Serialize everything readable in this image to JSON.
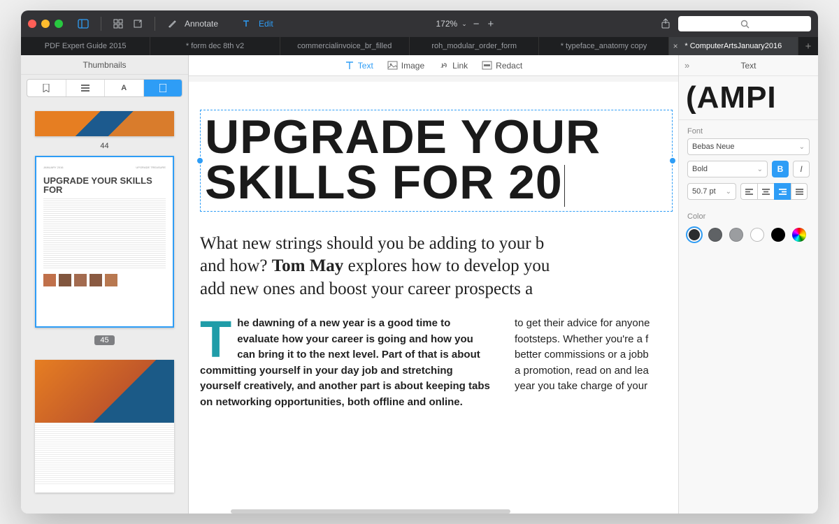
{
  "toolbar": {
    "annotate": "Annotate",
    "edit": "Edit",
    "zoom": "172%"
  },
  "search": {
    "placeholder": ""
  },
  "tabs": [
    {
      "label": "PDF Expert Guide 2015",
      "active": false
    },
    {
      "label": "* form dec 8th v2",
      "active": false
    },
    {
      "label": "commercialinvoice_br_filled",
      "active": false
    },
    {
      "label": "roh_modular_order_form",
      "active": false
    },
    {
      "label": "* typeface_anatomy copy",
      "active": false
    },
    {
      "label": "* ComputerArtsJanuary2016",
      "active": true
    }
  ],
  "sidebar": {
    "title": "Thumbnails",
    "pages": {
      "p44": "44",
      "p45": "45"
    },
    "thumb45": {
      "heading": "UPGRADE YOUR SKILLS FOR"
    }
  },
  "editbar": {
    "text": "Text",
    "image": "Image",
    "link": "Link",
    "redact": "Redact"
  },
  "doc": {
    "headline": "UPGRADE YOUR SKILLS FOR 20",
    "intro_a": "What new strings should you be adding to your b",
    "intro_b": "and how? ",
    "intro_bold": "Tom May",
    "intro_c": " explores how to develop you",
    "intro_d": "add new ones and boost your career prospects a",
    "dropcap": "T",
    "col1": "he dawning of a new year is a good time to evaluate how your career is going and how you can bring it to the next level. Part of that is about committing yourself in your day job and stretching yourself creatively, and another part is about keeping tabs on networking opportunities, both offline and online.",
    "col2_l1": "to get their advice for anyone",
    "col2_l2": "footsteps. Whether you're a f",
    "col2_l3": "better commissions or a jobb",
    "col2_l4": "a promotion, read on and lea",
    "col2_l5": "year you take charge of your"
  },
  "props": {
    "panel_title": "Text",
    "sample": "(AMPI",
    "font_label": "Font",
    "font_name": "Bebas Neue",
    "font_weight": "Bold",
    "font_size": "50.7 pt",
    "color_label": "Color",
    "bold": "B",
    "italic": "I",
    "colors": {
      "c1": "#2a2c2e",
      "c2": "#5f6265",
      "c3": "#9b9da0",
      "c4": "#ffffff",
      "c5": "#000000"
    }
  }
}
